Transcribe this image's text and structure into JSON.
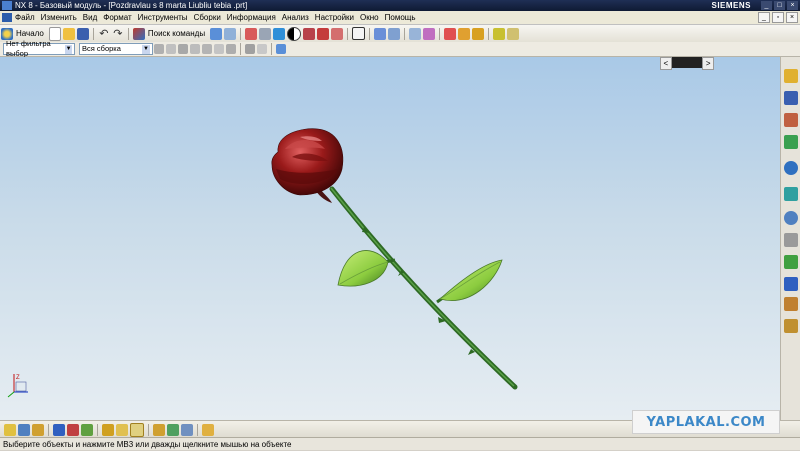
{
  "titlebar": {
    "text": "NX 8 - Базовый модуль - [Pozdravlau s 8 marta   Liubliu tebia .prt]",
    "brand": "SIEMENS"
  },
  "menubar": {
    "items": [
      "Файл",
      "Изменить",
      "Вид",
      "Формат",
      "Инструменты",
      "Сборки",
      "Информация",
      "Анализ",
      "Настройки",
      "Окно",
      "Помощь"
    ]
  },
  "toolbar": {
    "start_label": "Начало",
    "search_label": "Поиск команды"
  },
  "filters": {
    "type_filter": "Нет фильтра выбор",
    "assembly_filter": "Вся сборка"
  },
  "colors": {
    "viewport_top": "#a9c9e7",
    "viewport_bottom": "#e6edf2",
    "stem": "#3d7a2f",
    "leaf": "#8ccc3f",
    "rose": "#9a1a1a"
  },
  "watermark": "YAPLAKAL.COM",
  "status": "Выберите объекты и нажмите MB3 или дважды щелкните мышью на объекте"
}
